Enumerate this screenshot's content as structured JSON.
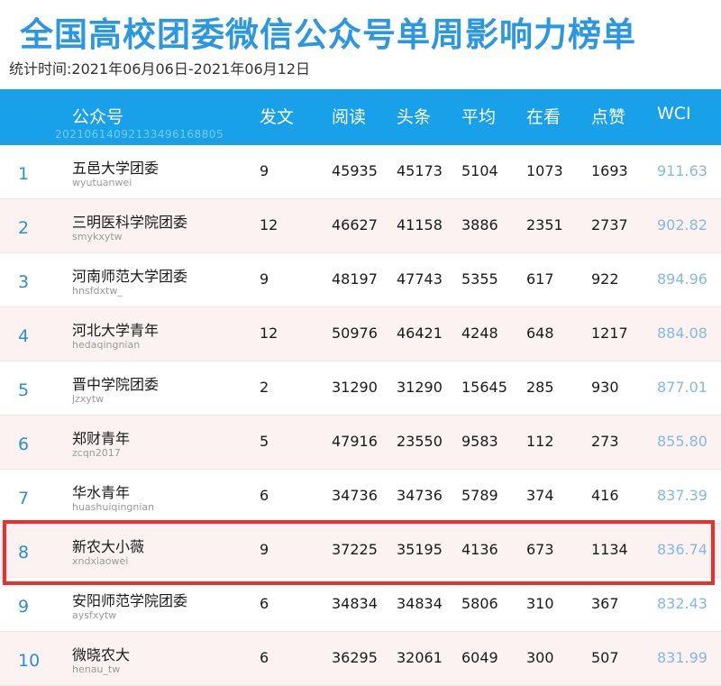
{
  "title": "全国高校团委微信公众号单周影响力榜单",
  "period": "统计时间:2021年06月06日-2021年06月12日",
  "header": {
    "account": "公众号",
    "watermark": "20210614092133496168805",
    "posts": "发文",
    "reads": "阅读",
    "top": "头条",
    "avg": "平均",
    "looking": "在看",
    "likes": "点赞",
    "wci": "WCI"
  },
  "rows": [
    {
      "rank": "1",
      "name": "五邑大学团委",
      "id": "wyutuanwei",
      "posts": "9",
      "reads": "45935",
      "top": "45173",
      "avg": "5104",
      "looking": "1073",
      "likes": "1693",
      "wci": "911.63"
    },
    {
      "rank": "2",
      "name": "三明医科学院团委",
      "id": "smykxytw",
      "posts": "12",
      "reads": "46627",
      "top": "41158",
      "avg": "3886",
      "looking": "2351",
      "likes": "2737",
      "wci": "902.82"
    },
    {
      "rank": "3",
      "name": "河南师范大学团委",
      "id": "hnsfdxtw_",
      "posts": "9",
      "reads": "48197",
      "top": "47743",
      "avg": "5355",
      "looking": "617",
      "likes": "922",
      "wci": "894.96"
    },
    {
      "rank": "4",
      "name": "河北大学青年",
      "id": "hedaqingnian",
      "posts": "12",
      "reads": "50976",
      "top": "46421",
      "avg": "4248",
      "looking": "648",
      "likes": "1217",
      "wci": "884.08"
    },
    {
      "rank": "5",
      "name": "晋中学院团委",
      "id": "jzxytw",
      "posts": "2",
      "reads": "31290",
      "top": "31290",
      "avg": "15645",
      "looking": "285",
      "likes": "930",
      "wci": "877.01"
    },
    {
      "rank": "6",
      "name": "郑财青年",
      "id": "zcqn2017",
      "posts": "5",
      "reads": "47916",
      "top": "23550",
      "avg": "9583",
      "looking": "112",
      "likes": "273",
      "wci": "855.80"
    },
    {
      "rank": "7",
      "name": "华水青年",
      "id": "huashuiqingnian",
      "posts": "6",
      "reads": "34736",
      "top": "34736",
      "avg": "5789",
      "looking": "374",
      "likes": "416",
      "wci": "837.39"
    },
    {
      "rank": "8",
      "name": "新农大小薇",
      "id": "xndxiaowei",
      "posts": "9",
      "reads": "37225",
      "top": "35195",
      "avg": "4136",
      "looking": "673",
      "likes": "1134",
      "wci": "836.74"
    },
    {
      "rank": "9",
      "name": "安阳师范学院团委",
      "id": "aysfxytw",
      "posts": "6",
      "reads": "34834",
      "top": "34834",
      "avg": "5806",
      "looking": "310",
      "likes": "367",
      "wci": "832.43"
    },
    {
      "rank": "10",
      "name": "微晓农大",
      "id": "henau_tw",
      "posts": "6",
      "reads": "36295",
      "top": "32061",
      "avg": "6049",
      "looking": "300",
      "likes": "507",
      "wci": "831.99"
    }
  ],
  "colors": {
    "title": "#2a97e0",
    "header_bg": "#18a0e8",
    "row_alt_bg": "#fcf2f2",
    "rank": "#2b8fd6",
    "wci": "#85b9e0",
    "highlight_border": "#f02d2d"
  },
  "highlighted_rank": "8"
}
